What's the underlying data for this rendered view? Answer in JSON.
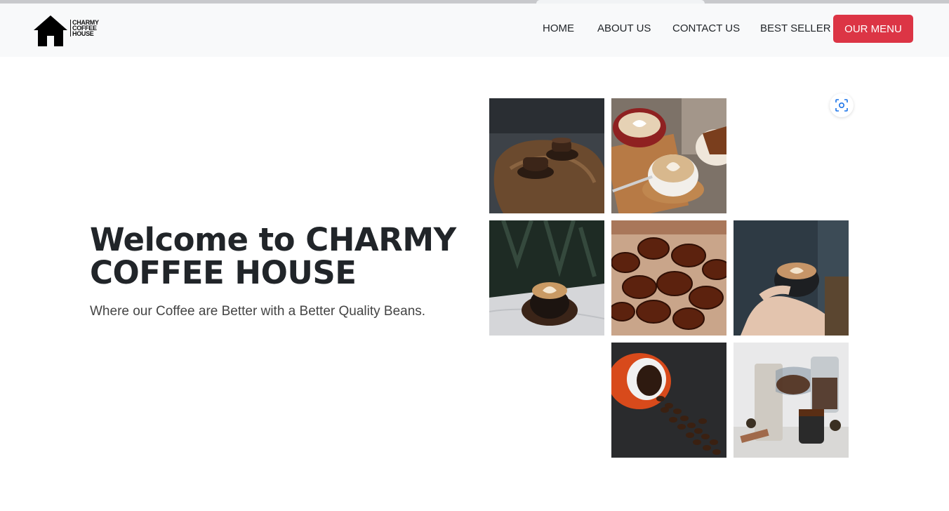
{
  "brand": {
    "logo_text": "CHARMY\nCOFFEE\nHOUSE"
  },
  "nav": {
    "items": [
      {
        "label": "HOME"
      },
      {
        "label": "ABOUT US"
      },
      {
        "label": "CONTACT US"
      },
      {
        "label": "BEST SELLER"
      }
    ],
    "cta_label": "OUR MENU"
  },
  "hero": {
    "title": "Welcome to CHARMY COFFEE HOUSE",
    "subtitle": "Where our Coffee are Better with a Better Quality Beans."
  },
  "gallery": {
    "images": [
      {
        "name": "coffee-table-cups-image"
      },
      {
        "name": "latte-art-cups-image"
      },
      {
        "name": "latte-on-marble-image"
      },
      {
        "name": "coffee-beans-closeup-image"
      },
      {
        "name": "hands-holding-latte-image"
      },
      {
        "name": "spilled-coffee-beans-image"
      },
      {
        "name": "french-press-pour-image"
      }
    ]
  },
  "icons": {
    "home_logo": "house-icon",
    "lens": "visual-search-icon"
  },
  "colors": {
    "accent": "#dc3545",
    "navbar_bg": "#f8f9fa",
    "text": "#212529"
  }
}
